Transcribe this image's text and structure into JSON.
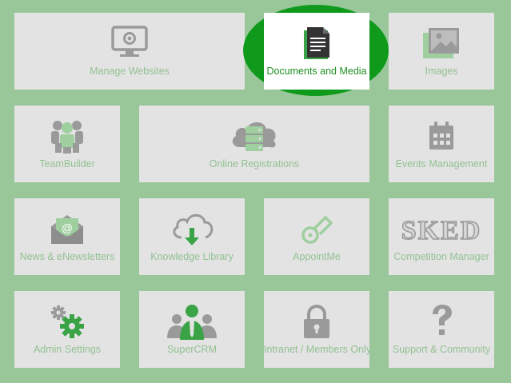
{
  "tiles": {
    "manage_websites": "Manage Websites",
    "documents_media": "Documents and Media",
    "images": "Images",
    "teambuilder": "TeamBuilder",
    "online_registrations": "Online Registrations",
    "events_management": "Events Management",
    "news": "News & eNewsletters",
    "knowledge_library": "Knowledge Library",
    "appointme": "AppointMe",
    "competition_manager": "Competition Manager",
    "competition_logo_text": "SKED",
    "admin_settings": "Admin Settings",
    "supercrm": "SuperCRM",
    "intranet": "Intranet / Members Only",
    "support": "Support & Community"
  },
  "icons": {
    "manage_websites": "monitor-icon",
    "documents_media": "document-icon",
    "images": "image-icon",
    "teambuilder": "team-icon",
    "online_registrations": "cloud-server-icon",
    "events_management": "calendar-icon",
    "news": "email-icon",
    "knowledge_library": "cloud-download-icon",
    "appointme": "whistle-icon",
    "competition_manager": "sked-logo",
    "admin_settings": "gears-icon",
    "supercrm": "people-icon",
    "intranet": "lock-icon",
    "support": "question-icon"
  },
  "colors": {
    "background": "#9ac79a",
    "tile": "#e3e3e3",
    "tile_label": "#93c193",
    "icon_gray": "#9a9a9a",
    "highlight_spot": "#0f9a1c",
    "highlight_label": "#1f8f22"
  }
}
